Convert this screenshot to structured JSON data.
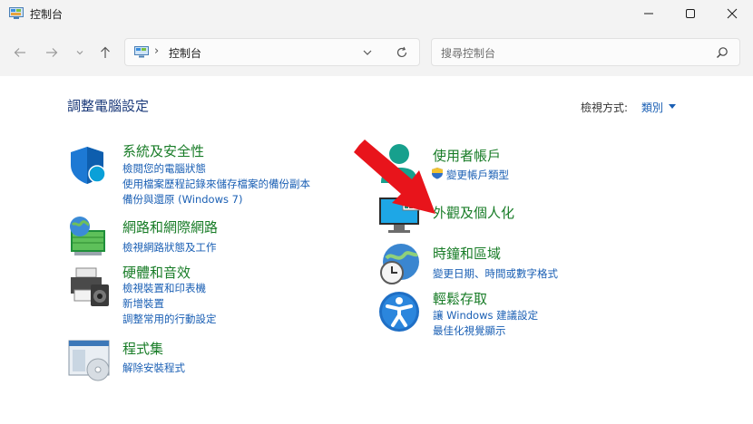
{
  "window": {
    "title": "控制台",
    "controls": [
      "minimize",
      "maximize",
      "close"
    ]
  },
  "nav": {
    "address_text": "控制台",
    "search_placeholder": "搜尋控制台"
  },
  "page": {
    "heading": "調整電腦設定",
    "view_by_label": "檢視方式:",
    "view_by_value": "類別"
  },
  "categories_left": [
    {
      "title": "系統及安全性",
      "icon": "shield-icon",
      "links": [
        "檢閱您的電腦狀態",
        "使用檔案歷程記錄來儲存檔案的備份副本",
        "備份與還原 (Windows 7)"
      ]
    },
    {
      "title": "網路和網際網路",
      "icon": "network-globe-icon",
      "links": [
        "檢視網路狀態及工作"
      ]
    },
    {
      "title": "硬體和音效",
      "icon": "printer-speaker-icon",
      "links": [
        "檢視裝置和印表機",
        "新增裝置",
        "調整常用的行動設定"
      ]
    },
    {
      "title": "程式集",
      "icon": "programs-disc-icon",
      "links": [
        "解除安裝程式"
      ]
    }
  ],
  "categories_right": [
    {
      "title": "使用者帳戶",
      "icon": "user-account-icon",
      "links": [
        "變更帳戶類型"
      ]
    },
    {
      "title": "外觀及個人化",
      "icon": "monitor-personalize-icon",
      "links": []
    },
    {
      "title": "時鐘和區域",
      "icon": "clock-globe-icon",
      "links": [
        "變更日期、時間或數字格式"
      ]
    },
    {
      "title": "輕鬆存取",
      "icon": "accessibility-icon",
      "links": [
        "讓 Windows 建議設定",
        "最佳化視覺顯示"
      ]
    }
  ],
  "colors": {
    "title_green": "#187c27",
    "link_blue": "#1a5fb4",
    "heading_blue": "#1b3a7a",
    "arrow_red": "#e8141b"
  }
}
